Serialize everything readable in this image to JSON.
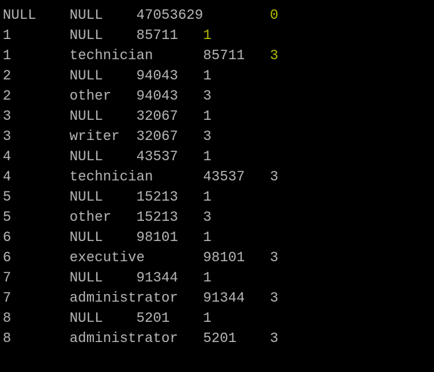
{
  "rows": [
    {
      "c1": {
        "t": "NULL",
        "color": "gray",
        "w": 8
      },
      "c2": {
        "t": "NULL",
        "color": "gray",
        "w": 8
      },
      "c3": {
        "t": "47053629",
        "color": "gray",
        "w": 16
      },
      "c4": {
        "t": "0",
        "color": "olive",
        "w": 1
      }
    },
    {
      "c1": {
        "t": "1",
        "color": "gray",
        "w": 8
      },
      "c2": {
        "t": "NULL",
        "color": "gray",
        "w": 8
      },
      "c3": {
        "t": "85711",
        "color": "gray",
        "w": 8
      },
      "c4": {
        "t": "1",
        "color": "olive",
        "w": 1
      }
    },
    {
      "c1": {
        "t": "1",
        "color": "gray",
        "w": 8
      },
      "c2": {
        "t": "technician",
        "color": "gray",
        "w": 16
      },
      "c3": {
        "t": "85711",
        "color": "gray",
        "w": 8
      },
      "c4": {
        "t": "3",
        "color": "olive",
        "w": 1
      }
    },
    {
      "c1": {
        "t": "2",
        "color": "gray",
        "w": 8
      },
      "c2": {
        "t": "NULL",
        "color": "gray",
        "w": 8
      },
      "c3": {
        "t": "94043",
        "color": "gray",
        "w": 8
      },
      "c4": {
        "t": "1",
        "color": "gray",
        "w": 1
      }
    },
    {
      "c1": {
        "t": "2",
        "color": "gray",
        "w": 8
      },
      "c2": {
        "t": "other",
        "color": "gray",
        "w": 8
      },
      "c3": {
        "t": "94043",
        "color": "gray",
        "w": 8
      },
      "c4": {
        "t": "3",
        "color": "gray",
        "w": 1
      }
    },
    {
      "c1": {
        "t": "3",
        "color": "gray",
        "w": 8
      },
      "c2": {
        "t": "NULL",
        "color": "gray",
        "w": 8
      },
      "c3": {
        "t": "32067",
        "color": "gray",
        "w": 8
      },
      "c4": {
        "t": "1",
        "color": "gray",
        "w": 1
      }
    },
    {
      "c1": {
        "t": "3",
        "color": "gray",
        "w": 8
      },
      "c2": {
        "t": "writer",
        "color": "gray",
        "w": 8
      },
      "c3": {
        "t": "32067",
        "color": "gray",
        "w": 8
      },
      "c4": {
        "t": "3",
        "color": "gray",
        "w": 1
      }
    },
    {
      "c1": {
        "t": "4",
        "color": "gray",
        "w": 8
      },
      "c2": {
        "t": "NULL",
        "color": "gray",
        "w": 8
      },
      "c3": {
        "t": "43537",
        "color": "gray",
        "w": 8
      },
      "c4": {
        "t": "1",
        "color": "gray",
        "w": 1
      }
    },
    {
      "c1": {
        "t": "4",
        "color": "gray",
        "w": 8
      },
      "c2": {
        "t": "technician",
        "color": "gray",
        "w": 16
      },
      "c3": {
        "t": "43537",
        "color": "gray",
        "w": 8
      },
      "c4": {
        "t": "3",
        "color": "gray",
        "w": 1
      }
    },
    {
      "c1": {
        "t": "5",
        "color": "gray",
        "w": 8
      },
      "c2": {
        "t": "NULL",
        "color": "gray",
        "w": 8
      },
      "c3": {
        "t": "15213",
        "color": "gray",
        "w": 8
      },
      "c4": {
        "t": "1",
        "color": "gray",
        "w": 1
      }
    },
    {
      "c1": {
        "t": "5",
        "color": "gray",
        "w": 8
      },
      "c2": {
        "t": "other",
        "color": "gray",
        "w": 8
      },
      "c3": {
        "t": "15213",
        "color": "gray",
        "w": 8
      },
      "c4": {
        "t": "3",
        "color": "gray",
        "w": 1
      }
    },
    {
      "c1": {
        "t": "6",
        "color": "gray",
        "w": 8
      },
      "c2": {
        "t": "NULL",
        "color": "gray",
        "w": 8
      },
      "c3": {
        "t": "98101",
        "color": "gray",
        "w": 8
      },
      "c4": {
        "t": "1",
        "color": "gray",
        "w": 1
      }
    },
    {
      "c1": {
        "t": "6",
        "color": "gray",
        "w": 8
      },
      "c2": {
        "t": "executive",
        "color": "gray",
        "w": 16
      },
      "c3": {
        "t": "98101",
        "color": "gray",
        "w": 8
      },
      "c4": {
        "t": "3",
        "color": "gray",
        "w": 1
      }
    },
    {
      "c1": {
        "t": "7",
        "color": "gray",
        "w": 8
      },
      "c2": {
        "t": "NULL",
        "color": "gray",
        "w": 8
      },
      "c3": {
        "t": "91344",
        "color": "gray",
        "w": 8
      },
      "c4": {
        "t": "1",
        "color": "gray",
        "w": 1
      }
    },
    {
      "c1": {
        "t": "7",
        "color": "gray",
        "w": 8
      },
      "c2": {
        "t": "administrator",
        "color": "gray",
        "w": 16
      },
      "c3": {
        "t": "91344",
        "color": "gray",
        "w": 8
      },
      "c4": {
        "t": "3",
        "color": "gray",
        "w": 1
      }
    },
    {
      "c1": {
        "t": "8",
        "color": "gray",
        "w": 8
      },
      "c2": {
        "t": "NULL",
        "color": "gray",
        "w": 8
      },
      "c3": {
        "t": "5201",
        "color": "gray",
        "w": 8
      },
      "c4": {
        "t": "1",
        "color": "gray",
        "w": 1
      }
    },
    {
      "c1": {
        "t": "8",
        "color": "gray",
        "w": 8
      },
      "c2": {
        "t": "administrator",
        "color": "gray",
        "w": 16
      },
      "c3": {
        "t": "5201",
        "color": "gray",
        "w": 8
      },
      "c4": {
        "t": "3",
        "color": "gray",
        "w": 1
      }
    }
  ]
}
